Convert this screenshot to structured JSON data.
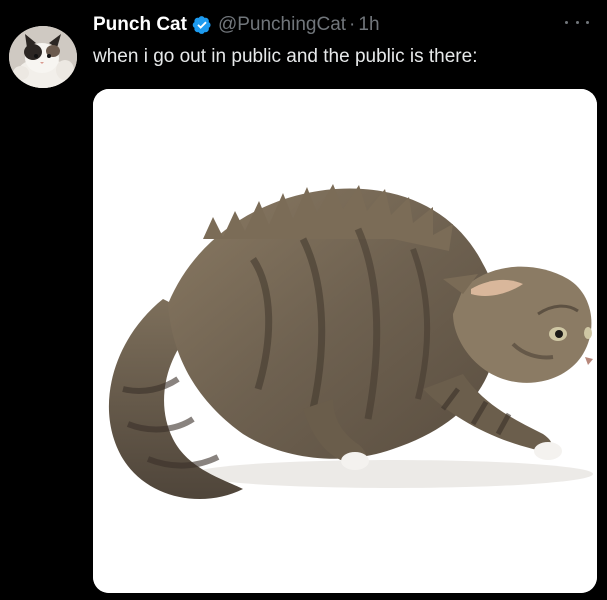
{
  "author": {
    "display_name": "Punch Cat",
    "handle": "@PunchingCat",
    "separator": "·",
    "time": "1h",
    "verified_icon": "verified-badge-icon",
    "verified_color": "#1d9bf0"
  },
  "post": {
    "text": "when i go out in public and the public is there:"
  },
  "menu": {
    "icon": "more-options-icon"
  },
  "colors": {
    "background": "#000000",
    "primary_text": "#e7e9ea",
    "secondary_text": "#71767b",
    "media_background": "#ffffff"
  }
}
